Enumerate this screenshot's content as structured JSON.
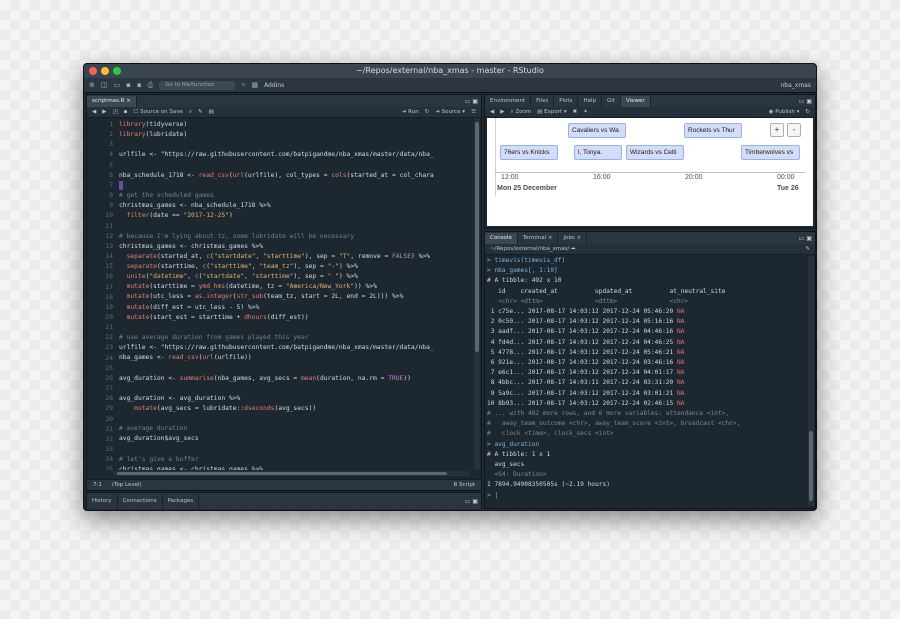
{
  "window": {
    "title": "~/Repos/external/nba_xmas - master - RStudio"
  },
  "toolbar": {
    "goto_placeholder": "Go to file/function",
    "addins_label": "Addins",
    "project_label": "nba_xmas"
  },
  "editor": {
    "tab_label": "scriptmas.R",
    "source_on_save": "Source on Save",
    "run_label": "Run",
    "source_label": "Source",
    "status_position": "7:1",
    "status_scope": "(Top Level)",
    "status_type": "R Script",
    "lines": [
      {
        "n": "1",
        "text": "library(tidyverse)"
      },
      {
        "n": "2",
        "text": "library(lubridate)"
      },
      {
        "n": "3",
        "text": ""
      },
      {
        "n": "4",
        "text": "urlfile <- \"https://raw.githubusercontent.com/batpigandme/nba_xmas/master/data/nba_"
      },
      {
        "n": "5",
        "text": ""
      },
      {
        "n": "6",
        "text": "nba_schedule_1718 <- read_csv(url(urlfile), col_types = cols(started_at = col_chara"
      },
      {
        "n": "7",
        "text": ""
      },
      {
        "n": "8",
        "text": "# get the scheduled games"
      },
      {
        "n": "9",
        "text": "christmas_games <- nba_schedule_1718 %>%"
      },
      {
        "n": "10",
        "text": "  filter(date == \"2017-12-25\")"
      },
      {
        "n": "11",
        "text": ""
      },
      {
        "n": "12",
        "text": "# because I'm lying about tz, some lubridate will be necessary"
      },
      {
        "n": "13",
        "text": "christmas_games <- christmas_games %>%"
      },
      {
        "n": "14",
        "text": "  separate(started_at, c(\"startdate\", \"starttime\"), sep = \"T\", remove = FALSE) %>%"
      },
      {
        "n": "15",
        "text": "  separate(starttime, c(\"starttime\", \"team_tz\"), sep = \"-\") %>%"
      },
      {
        "n": "16",
        "text": "  unite(\"datetime\", c(\"startdate\", \"starttime\"), sep = \" \") %>%"
      },
      {
        "n": "17",
        "text": "  mutate(starttime = ymd_hms(datetime, tz = \"America/New_York\")) %>%"
      },
      {
        "n": "18",
        "text": "  mutate(utc_less = as.integer(str_sub(team_tz, start = 2L, end = 2L))) %>%"
      },
      {
        "n": "19",
        "text": "  mutate(diff_est = utc_less - 5) %>%"
      },
      {
        "n": "20",
        "text": "  mutate(start_est = starttime + dhours(diff_est))"
      },
      {
        "n": "21",
        "text": ""
      },
      {
        "n": "22",
        "text": "# use average duration from games played this year"
      },
      {
        "n": "23",
        "text": "urlfile <- \"https://raw.githubusercontent.com/batpigandme/nba_xmas/master/data/nba_"
      },
      {
        "n": "24",
        "text": "nba_games <- read_csv(url(urlfile))"
      },
      {
        "n": "25",
        "text": ""
      },
      {
        "n": "26",
        "text": "avg_duration <- summarise(nba_games, avg_secs = mean(duration, na.rm = TRUE))"
      },
      {
        "n": "27",
        "text": ""
      },
      {
        "n": "28",
        "text": "avg_duration <- avg_duration %>%"
      },
      {
        "n": "29",
        "text": "    mutate(avg_secs = lubridate::dseconds(avg_secs))"
      },
      {
        "n": "30",
        "text": ""
      },
      {
        "n": "31",
        "text": "# average duration"
      },
      {
        "n": "32",
        "text": "avg_duration$avg_secs"
      },
      {
        "n": "33",
        "text": ""
      },
      {
        "n": "34",
        "text": "# let's give a buffer"
      },
      {
        "n": "35",
        "text": "christmas_games <- christmas_games %>%"
      }
    ]
  },
  "viewer": {
    "tabs": [
      "Environment",
      "Files",
      "Plots",
      "Help",
      "Git",
      "Viewer"
    ],
    "active_tab": "Viewer",
    "zoom_label": "Zoom",
    "export_label": "Export",
    "publish_label": "Publish",
    "items": [
      {
        "label": "Cavaliers vs Wa"
      },
      {
        "label": "Rockets vs Thur"
      },
      {
        "label": "76ers vs Knicks"
      },
      {
        "label": "l, Tonya."
      },
      {
        "label": "Wizards vs Celti"
      },
      {
        "label": "Timberwolves vs"
      }
    ],
    "ticks": [
      "12:00",
      "16:00",
      "20:00",
      "00:00"
    ],
    "major": [
      "Mon 25 December",
      "Tue 26"
    ],
    "zoom_in": "+",
    "zoom_out": "-"
  },
  "console": {
    "tabs": [
      "Console",
      "Terminal",
      "Jobs"
    ],
    "path": "~/Repos/external/nba_xmas/",
    "lines": [
      {
        "cls": "c-blue",
        "text": "> timevis(timevis_df)"
      },
      {
        "cls": "c-blue",
        "text": "> nba_games[, 1:10]"
      },
      {
        "cls": "",
        "text": "# A tibble: 492 x 10"
      },
      {
        "cls": "",
        "text": "   id    created_at          updated_at          at_neutral_site"
      },
      {
        "cls": "c-dim",
        "text": "   <chr> <dttm>              <dttm>              <chr>"
      },
      {
        "cls": "",
        "text": " 1 c75e... 2017-08-17 14:03:12 2017-12-24 05:46:20 NA"
      },
      {
        "cls": "",
        "text": " 2 0c50... 2017-08-17 14:03:12 2017-12-24 05:16:16 NA"
      },
      {
        "cls": "",
        "text": " 3 aadf... 2017-08-17 14:03:12 2017-12-24 04:46:16 NA"
      },
      {
        "cls": "",
        "text": " 4 fd4d... 2017-08-17 14:03:12 2017-12-24 04:46:25 NA"
      },
      {
        "cls": "",
        "text": " 5 4778... 2017-08-17 14:03:12 2017-12-24 05:46:21 NA"
      },
      {
        "cls": "",
        "text": " 6 921e... 2017-08-17 14:03:12 2017-12-24 03:46:16 NA"
      },
      {
        "cls": "",
        "text": " 7 e6c1... 2017-08-17 14:03:12 2017-12-24 04:01:17 NA"
      },
      {
        "cls": "",
        "text": " 8 4bbc... 2017-08-17 14:03:11 2017-12-24 03:31:20 NA"
      },
      {
        "cls": "",
        "text": " 9 5a9c... 2017-08-17 14:03:12 2017-12-24 03:01:21 NA"
      },
      {
        "cls": "",
        "text": "10 8b93... 2017-08-17 14:03:12 2017-12-24 02:46:15 NA"
      },
      {
        "cls": "c-dim",
        "text": "# ... with 482 more rows, and 6 more variables: attendance <int>,"
      },
      {
        "cls": "c-dim",
        "text": "#   away_team_outcome <chr>, away_team_score <int>, broadcast <chr>,"
      },
      {
        "cls": "c-dim",
        "text": "#   clock <time>, clock_secs <int>"
      },
      {
        "cls": "c-blue",
        "text": "> avg_duration"
      },
      {
        "cls": "",
        "text": "# A tibble: 1 x 1"
      },
      {
        "cls": "",
        "text": "  avg_secs"
      },
      {
        "cls": "c-dim",
        "text": "  <S4: Duration>"
      },
      {
        "cls": "",
        "text": "1 7894.94908350505s (~2.19 hours)"
      },
      {
        "cls": "c-blue",
        "text": "> |"
      }
    ]
  },
  "bottom_left": {
    "tabs": [
      "History",
      "Connections",
      "Packages"
    ]
  }
}
